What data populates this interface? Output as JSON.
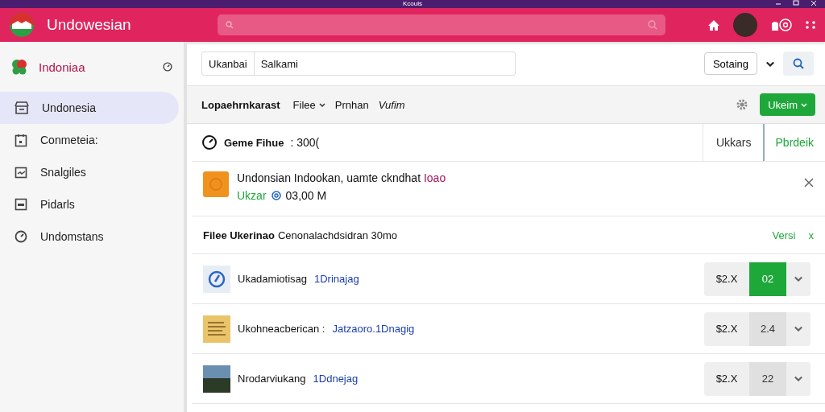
{
  "window": {
    "title": "Kcouls"
  },
  "header": {
    "app_name": "Undowesian"
  },
  "sidebar": {
    "title": "Indoniaa",
    "items": [
      {
        "label": "Undonesia",
        "selected": true
      },
      {
        "label": "Conmeteia:",
        "selected": false
      },
      {
        "label": "Snalgiles",
        "selected": false
      },
      {
        "label": "Pidarls",
        "selected": false
      },
      {
        "label": "Undomstans",
        "selected": false
      }
    ]
  },
  "search_bar": {
    "scope": "Ukanbai",
    "value": "Salkami",
    "sort": "Sotaing"
  },
  "toolbar": {
    "title": "Lopaehrnkarast",
    "menus": [
      {
        "label": "Filee",
        "dropdown": true
      },
      {
        "label": "Prnhan",
        "dropdown": false
      },
      {
        "label": "Vufim",
        "dropdown": false
      }
    ],
    "action": "Ukeim"
  },
  "filter_bar": {
    "label": "Geme Fihue",
    "value": ": 300(",
    "tabs": [
      {
        "label": "Ukkars",
        "selected": false
      },
      {
        "label": "Pbrdeik",
        "selected": true
      }
    ]
  },
  "notice": {
    "title": "Undonsian Indookan, uamte ckndhat",
    "tag": "Ioao",
    "status": "Ukzar",
    "meta": "03,00 M"
  },
  "section": {
    "label": "Filee Ukerinao",
    "detail": "Cenonalachdsidran 30mo",
    "action": "Versi",
    "close": "x"
  },
  "items": [
    {
      "kind": "icon",
      "name": "Ukadamiotisag",
      "link": "1Drinajag",
      "price": "$2.X",
      "qty": "02",
      "selected": true
    },
    {
      "kind": "document",
      "name": "Ukohneacberican :",
      "link": "Jatzaoro.1Dnagig",
      "price": "$2.X",
      "qty": "2.4",
      "selected": false
    },
    {
      "kind": "photo",
      "name": "Nrodarviukang",
      "link": "1Ddnejag",
      "price": "$2.X",
      "qty": "22",
      "selected": false
    }
  ]
}
